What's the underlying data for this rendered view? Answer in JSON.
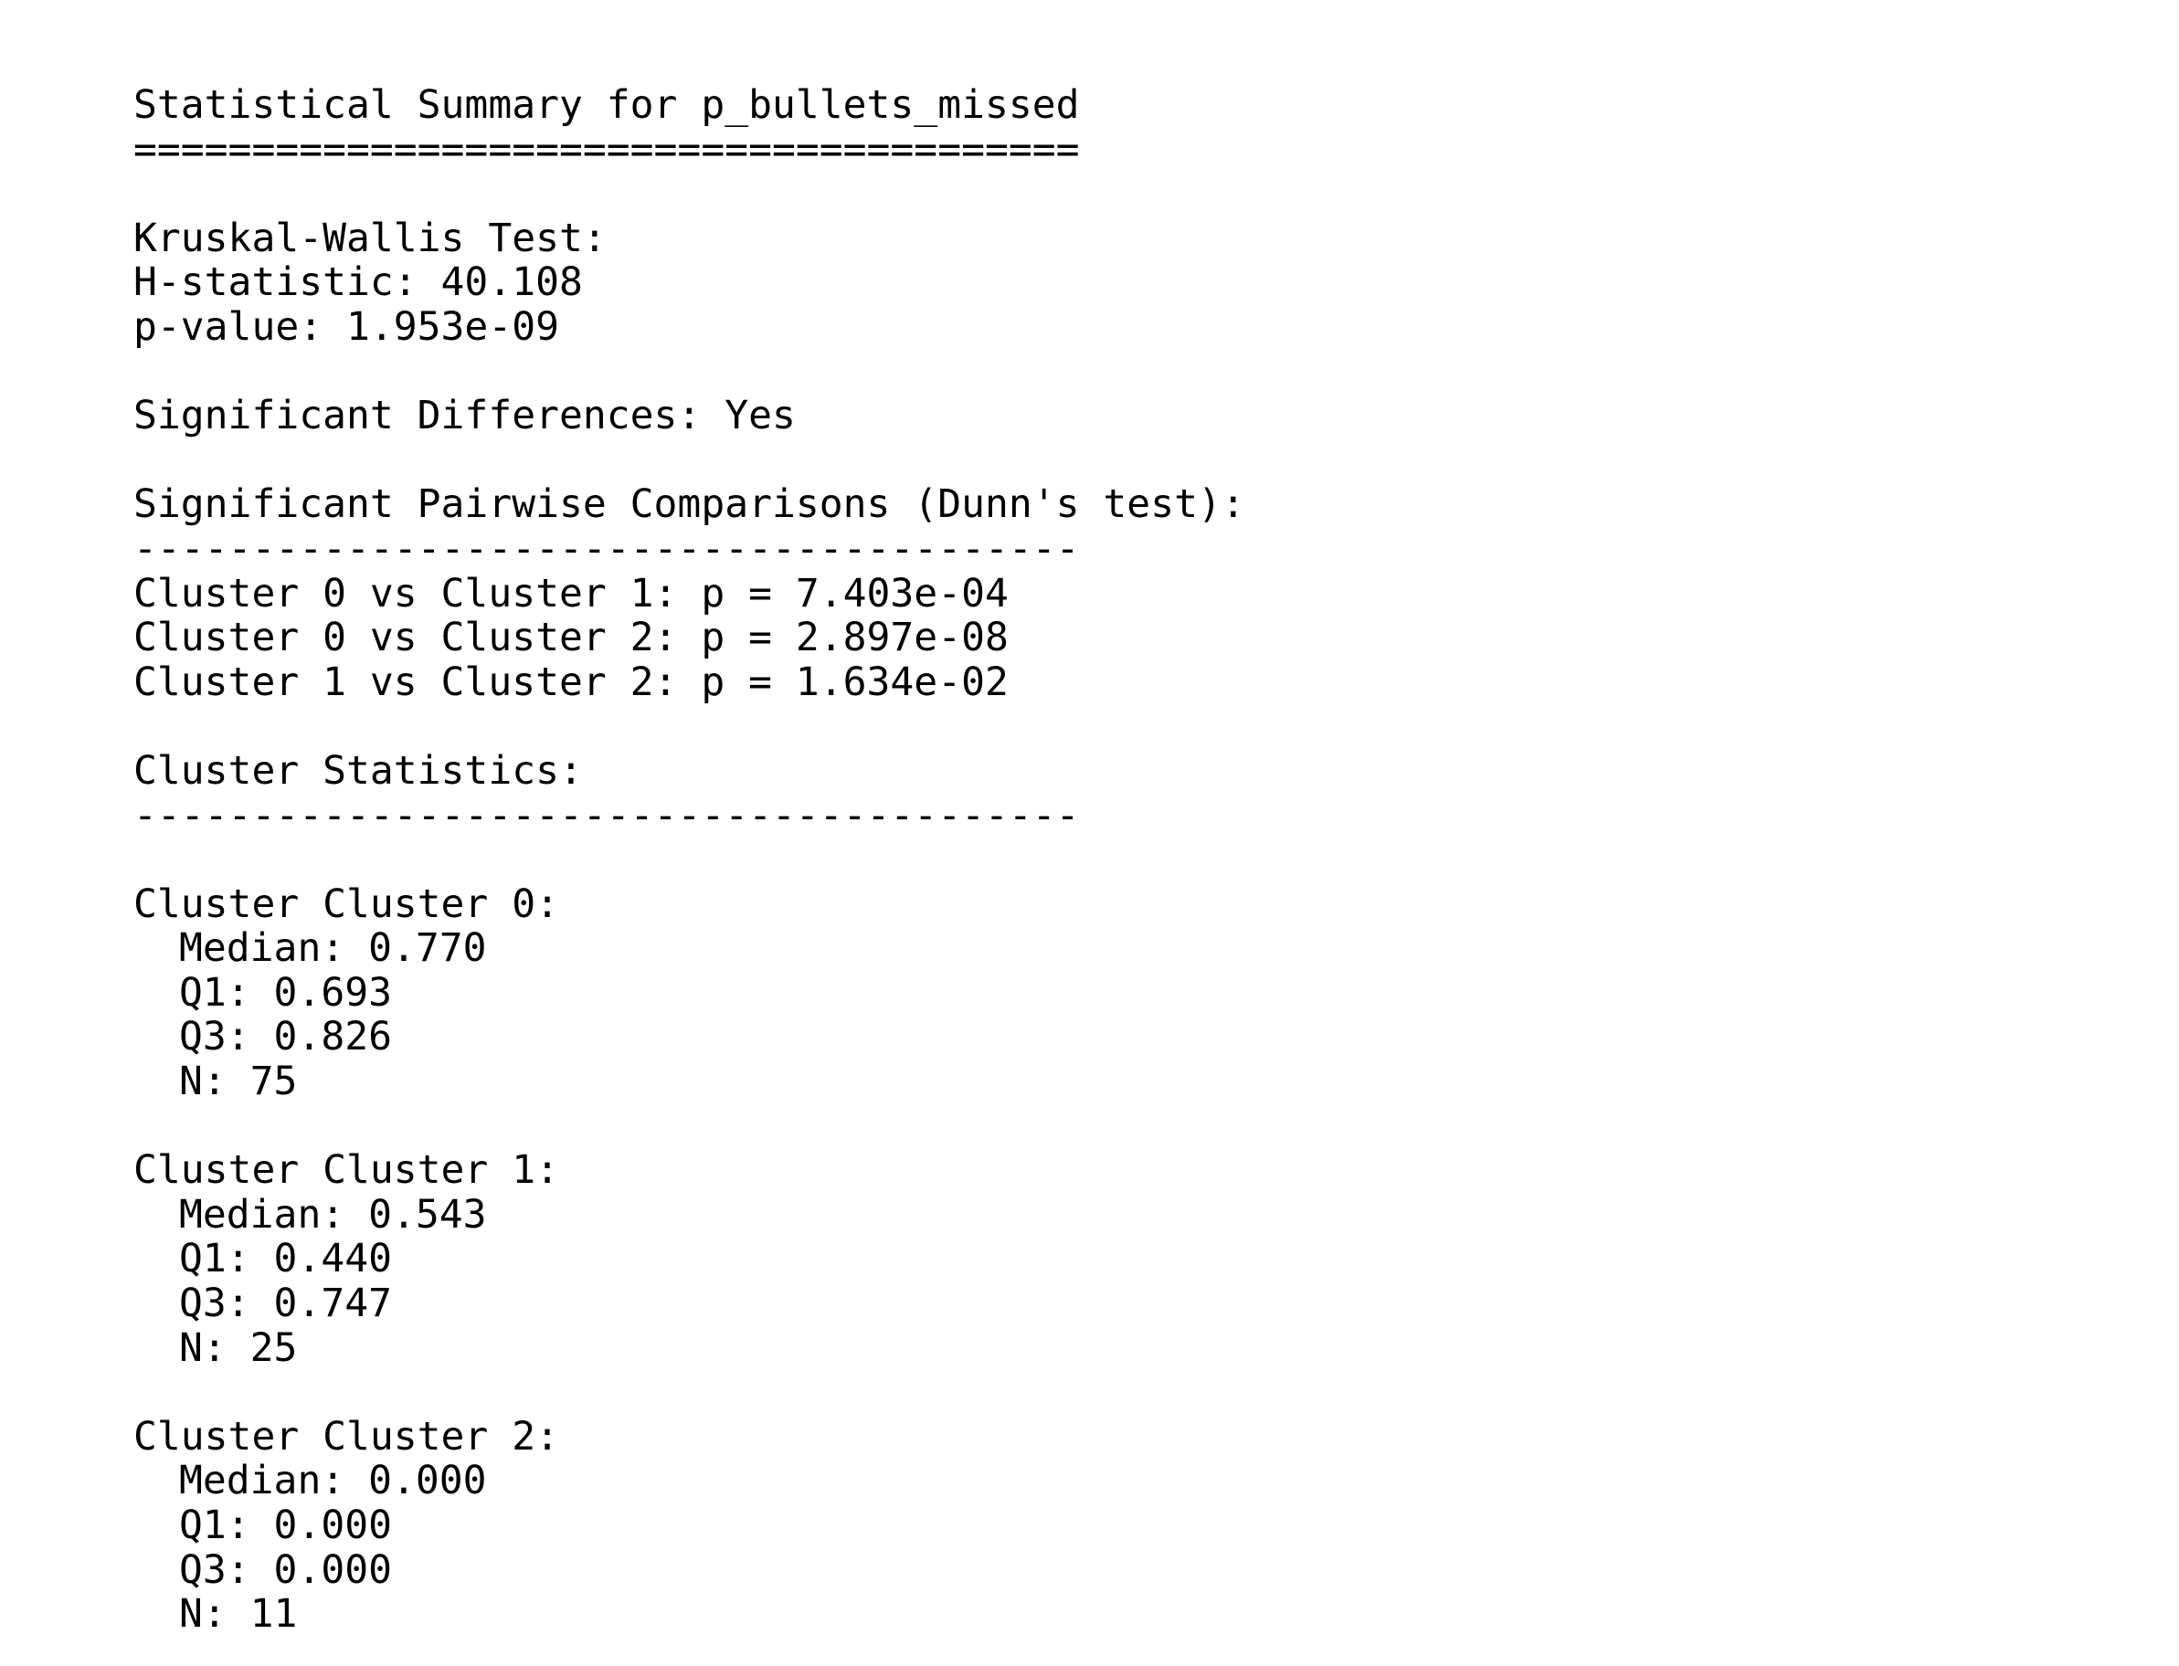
{
  "title": "Statistical Summary for p_bullets_missed",
  "title_rule": "========================================",
  "kruskal": {
    "heading": "Kruskal-Wallis Test:",
    "h_statistic": "H-statistic: 40.108",
    "p_value": "p-value: 1.953e-09"
  },
  "significance": "Significant Differences: Yes",
  "pairwise": {
    "heading": "Significant Pairwise Comparisons (Dunn's test):",
    "rule": "----------------------------------------",
    "comparisons": [
      "Cluster 0 vs Cluster 1: p = 7.403e-04",
      "Cluster 0 vs Cluster 2: p = 2.897e-08",
      "Cluster 1 vs Cluster 2: p = 1.634e-02"
    ]
  },
  "cluster_stats": {
    "heading": "Cluster Statistics:",
    "rule": "----------------------------------------",
    "clusters": [
      {
        "header": "Cluster Cluster 0:",
        "median": "Median: 0.770",
        "q1": "Q1: 0.693",
        "q3": "Q3: 0.826",
        "n": "N: 75"
      },
      {
        "header": "Cluster Cluster 1:",
        "median": "Median: 0.543",
        "q1": "Q1: 0.440",
        "q3": "Q3: 0.747",
        "n": "N: 25"
      },
      {
        "header": "Cluster Cluster 2:",
        "median": "Median: 0.000",
        "q1": "Q1: 0.000",
        "q3": "Q3: 0.000",
        "n": "N: 11"
      }
    ]
  }
}
